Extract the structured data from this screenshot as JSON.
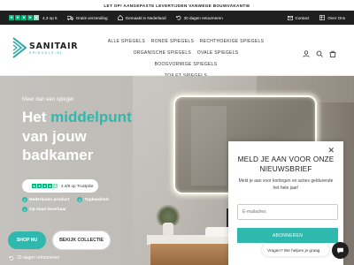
{
  "announcement": "LET OP! AANGEPASTE LEVERTIJDEN VANWEGE BOUWVAKANTIE",
  "usp_bar": {
    "rating": "4,3 op 5",
    "free_shipping": "Gratis verzending",
    "made_in": "Gemaakt in Nederland",
    "returns": "30 dagen retourneren",
    "contact": "Contact",
    "about": "Over Ons"
  },
  "logo": {
    "main": "SANITAIR",
    "sub": "SPIEGELS.NL"
  },
  "nav": {
    "items": [
      "ALLE SPIEGELS",
      "RONDE SPIEGELS",
      "RECHTHOEKIGE SPIEGELS",
      "ORGANISCHE SPIEGELS",
      "OVALE SPIEGELS",
      "BOOGVORMIGE SPIEGELS",
      "TOILET SPIEGELS"
    ]
  },
  "hero": {
    "kicker": "Meer dan een spiegel.",
    "headline_1": "Het ",
    "headline_accent": "middelpunt",
    "headline_2": "van jouw",
    "headline_3": "badkamer",
    "rating_text": "4.4/5 op Trustpilot",
    "usp_1": "Nederlands product",
    "usp_2": "Topkwaliteit",
    "usp_3": "Op maat leverbaar",
    "shop_button": "SHOP NU",
    "collection_button": "BEKIJK COLLECTIE",
    "returns": "30 dagen retourneren"
  },
  "popup": {
    "title": "MELD JE AAN VOOR ONZE NIEUWSBRIEF",
    "text": "Meld je aan voor kortingen en acties geldurende het hele jaar!",
    "email_placeholder": "E-mailadres",
    "submit": "ABONNEREN"
  },
  "chat": {
    "text": "Vragen? We helpen je graag"
  },
  "colors": {
    "accent": "#2fb8ad",
    "trustpilot": "#00b67a",
    "dark": "#1f1f1f"
  }
}
